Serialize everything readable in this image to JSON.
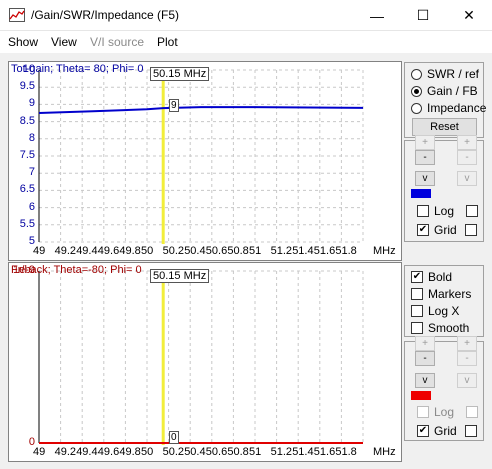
{
  "window": {
    "title": "/Gain/SWR/Impedance (F5)",
    "minimize_glyph": "—",
    "maximize_glyph": "☐",
    "close_glyph": "✕"
  },
  "menu": [
    "Show",
    "View",
    "V/I source",
    "Plot"
  ],
  "chart_data": [
    {
      "type": "line",
      "title": "Tot-gain; Theta= 80; Phi= 0",
      "title_color": "#0000a0",
      "series_color": "#0000cc",
      "ylim": [
        5,
        10
      ],
      "y_ticks": [
        "10",
        "9.5",
        "9",
        "8.5",
        "8",
        "7.5",
        "7",
        "6.5",
        "6",
        "5.5",
        "5"
      ],
      "x_ticks": [
        "49",
        "49.2",
        "49.4",
        "49.6",
        "49.8",
        "50",
        "50.2",
        "50.4",
        "50.6",
        "50.8",
        "51",
        "51.2",
        "51.4",
        "51.6",
        "51.8"
      ],
      "xlabel": "MHz",
      "xlim": [
        49,
        52
      ],
      "x": [
        49,
        49.5,
        50,
        50.15,
        50.5,
        51,
        51.5,
        52
      ],
      "y": [
        8.75,
        8.8,
        8.86,
        8.89,
        8.92,
        8.92,
        8.91,
        8.9
      ],
      "cursor_x": 50.15,
      "cursor_label": "50.15 MHz",
      "cursor_value": "9"
    },
    {
      "type": "line",
      "title": "Fr/back; Theta=-80; Phi= 0",
      "title_color": "#a00000",
      "series_color": "#e00000",
      "ylim": [
        0,
        1e-09
      ],
      "y_ticks": [
        "1e-9",
        "0"
      ],
      "x_ticks": [
        "49",
        "49.2",
        "49.4",
        "49.6",
        "49.8",
        "50",
        "50.2",
        "50.4",
        "50.6",
        "50.8",
        "51",
        "51.2",
        "51.4",
        "51.6",
        "51.8"
      ],
      "xlabel": "MHz",
      "xlim": [
        49,
        52
      ],
      "x": [
        49,
        52
      ],
      "y": [
        0,
        0
      ],
      "cursor_x": 50.15,
      "cursor_label": "50.15 MHz",
      "cursor_value": "0"
    }
  ],
  "panel_top": {
    "radios": [
      {
        "label": "SWR / ref",
        "selected": false
      },
      {
        "label": "Gain / FB",
        "selected": true
      },
      {
        "label": "Impedance",
        "selected": false
      }
    ],
    "reset_label": "Reset",
    "btn_plus": "+",
    "btn_minus": "-",
    "btn_v": "v",
    "swatch_color": "#0000dd",
    "log_label": "Log",
    "grid_label": "Grid",
    "check_mark": "✔"
  },
  "panel_bottom": {
    "checks": [
      {
        "label": "Bold",
        "checked": true
      },
      {
        "label": "Markers",
        "checked": false
      },
      {
        "label": "Log X",
        "checked": false
      },
      {
        "label": "Smooth",
        "checked": false
      }
    ],
    "btn_plus": "+",
    "btn_minus": "-",
    "btn_v": "v",
    "swatch_color": "#ee0000",
    "log_label": "Log",
    "grid_label": "Grid",
    "check_mark": "✔"
  }
}
